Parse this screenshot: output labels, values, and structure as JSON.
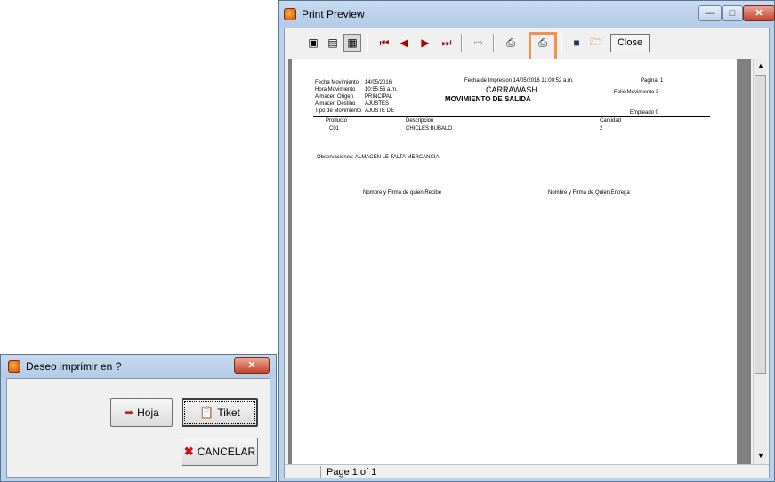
{
  "print_preview": {
    "title": "Print Preview",
    "close_label": "Close",
    "status": "Page 1 of 1",
    "report": {
      "fecha_mov_label": "Fecha Movimiento",
      "fecha_mov_value": "14/05/2016",
      "hora_mov_label": "Hora Movimiento",
      "hora_mov_value": "10:55:56 a.m.",
      "almacen_origen_label": "Almacen Origen",
      "almacen_origen_value": "PRINCIPAL",
      "almacen_destino_label": "Almacen Destino",
      "almacen_destino_value": "AJUSTES",
      "tipo_mov_label": "Tipo de Movimiento",
      "tipo_mov_value": "AJUSTE DE",
      "fecha_impresion": "Fecha de Impresion  14/05/2016 11:00:52 a.m.",
      "company": "CARRAWASH",
      "report_title": "MOVIMIENTO DE SALIDA",
      "pagina": "Pagina: 1",
      "folio": "Folio Movimiento 3",
      "empleado": "Empleado 0",
      "columns": [
        "Producto",
        "Descripcion",
        "Cantidad"
      ],
      "rows": [
        [
          "C01",
          "CHICLES BUBALO",
          "2"
        ]
      ],
      "observaciones": "Observaciones: ALMACEN LE FALTA MERCANCIA",
      "sign_left": "Nombre y Firma de quien Recibe",
      "sign_right": "Nombre y Firma de Quien Entrega"
    }
  },
  "dialog": {
    "title": "Deseo imprimir en ?",
    "hoja_label": "Hoja",
    "tiket_label": "Tiket",
    "cancelar_label": "CANCELAR"
  }
}
